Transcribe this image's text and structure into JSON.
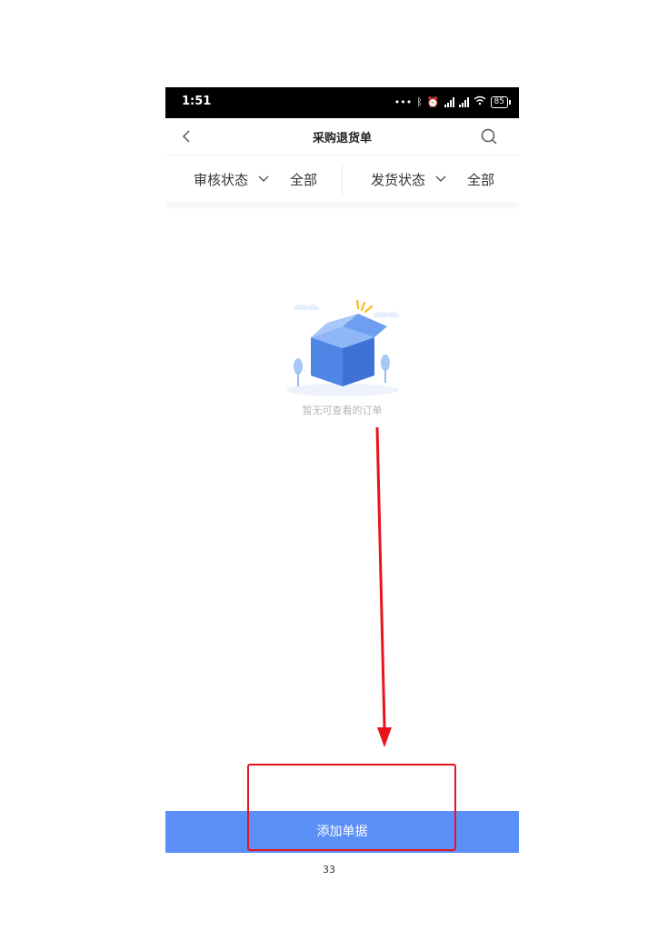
{
  "statusbar": {
    "time": "1:51",
    "battery": "85",
    "icons": [
      "more-dots-icon",
      "bluetooth-icon",
      "alarm-icon",
      "signal-icon",
      "signal-icon",
      "wifi-icon",
      "battery-icon"
    ]
  },
  "navbar": {
    "title": "采购退货单"
  },
  "filters": [
    {
      "label": "审核状态",
      "value": "全部"
    },
    {
      "label": "发货状态",
      "value": "全部"
    }
  ],
  "empty_state": {
    "message": "暂无可查看的订单"
  },
  "add_button": {
    "label": "添加单据"
  },
  "page_number": "33",
  "colors": {
    "primary": "#5a8ff7",
    "annotation": "#e8141c",
    "muted_text": "#b5b5b5"
  }
}
